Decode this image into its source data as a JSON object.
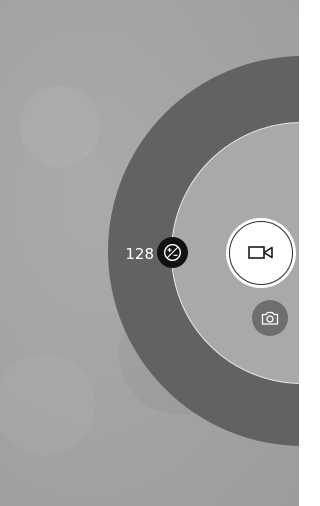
{
  "camera": {
    "exposure": {
      "value": "128",
      "icon": "exposure-icon"
    },
    "capture_mode": {
      "icon": "video-camera-icon"
    },
    "switch_mode": {
      "icon": "camera-icon"
    }
  }
}
